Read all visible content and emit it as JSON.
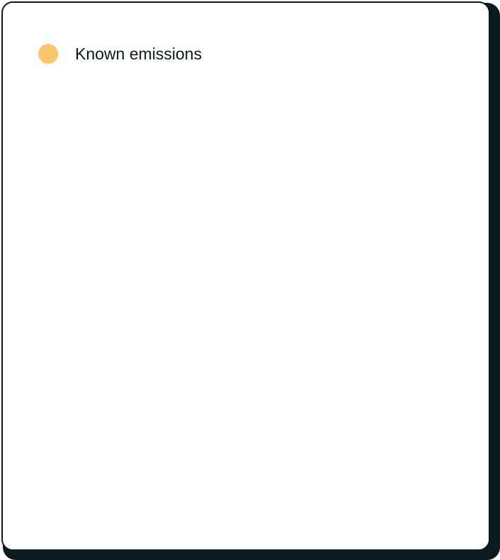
{
  "legend": {
    "items": [
      {
        "label": "Known emissions",
        "color": "#fcc46b"
      }
    ]
  },
  "colors": {
    "card_border": "#0b1a1c",
    "card_background": "#ffffff",
    "text": "#0b1a1c"
  }
}
